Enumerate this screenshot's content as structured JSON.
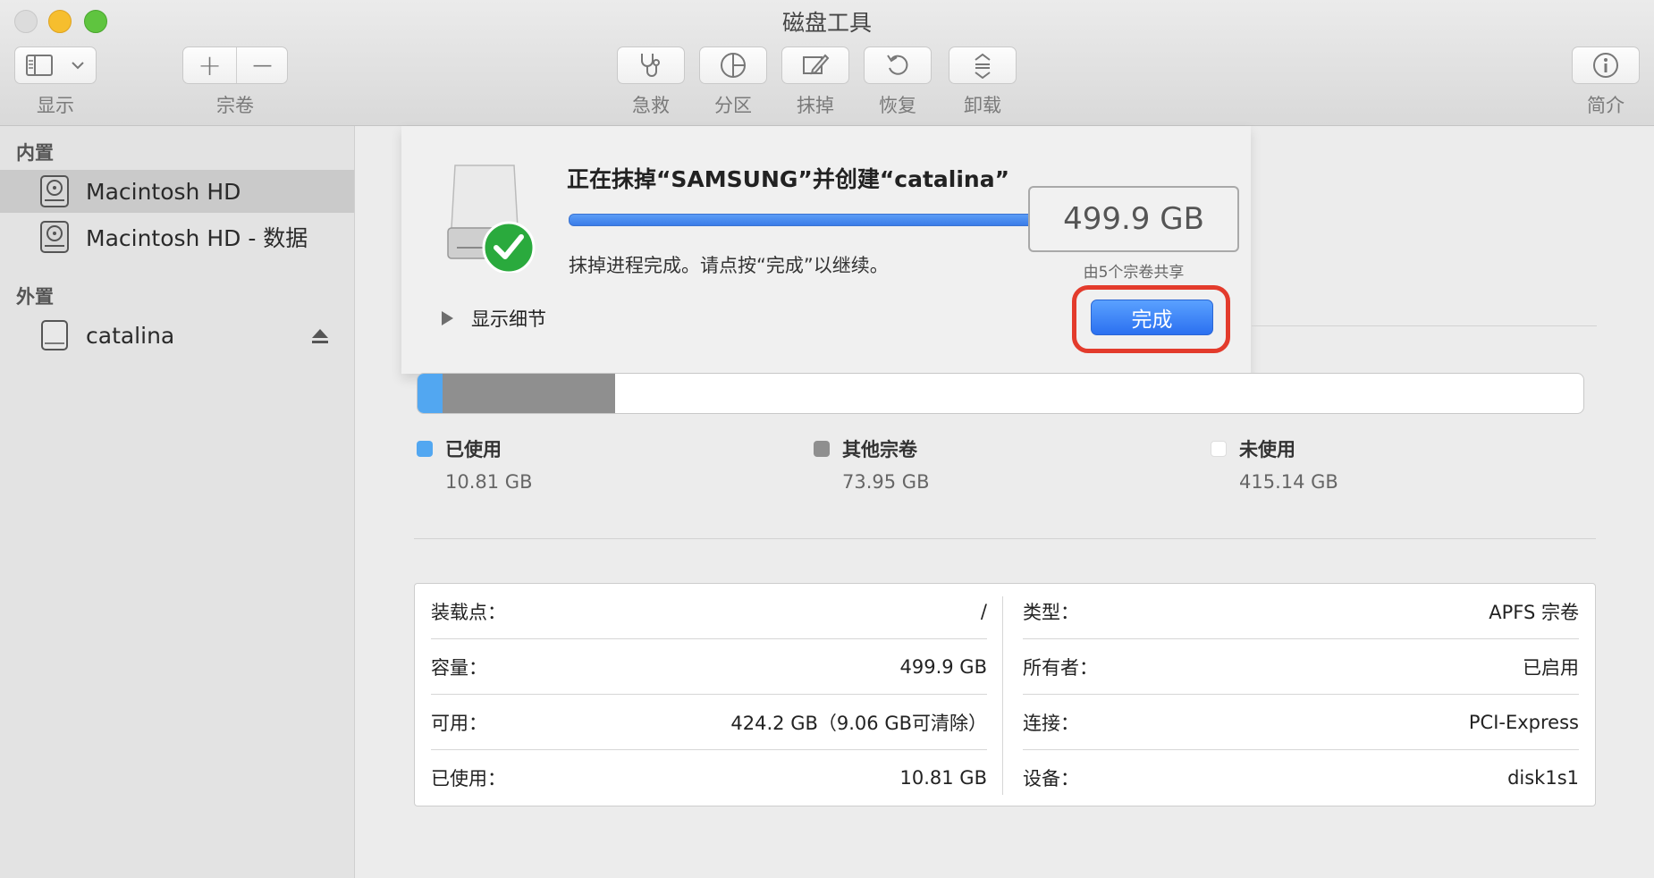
{
  "window": {
    "title": "磁盘工具"
  },
  "toolbar": {
    "view_label": "显示",
    "volume_label": "宗卷",
    "firstaid_label": "急救",
    "partition_label": "分区",
    "erase_label": "抹掉",
    "restore_label": "恢复",
    "unmount_label": "卸载",
    "info_label": "简介",
    "add_symbol": "+",
    "remove_symbol": "—"
  },
  "sidebar": {
    "internal_header": "内置",
    "external_header": "外置",
    "internal_items": [
      {
        "label": "Macintosh HD",
        "selected": true
      },
      {
        "label": "Macintosh HD - 数据",
        "selected": false
      }
    ],
    "external_items": [
      {
        "label": "catalina"
      }
    ]
  },
  "sheet": {
    "title": "正在抹掉“SAMSUNG”并创建“catalina”",
    "progress": 1.0,
    "message": "抹掉进程完成。请点按“完成”以继续。",
    "details_label": "显示细节",
    "done_label": "完成"
  },
  "capacity": {
    "value": "499.9 GB",
    "subtitle": "由5个宗卷共享"
  },
  "usage": {
    "used_label": "已使用",
    "used_value": "10.81 GB",
    "used_fraction": 0.0216,
    "other_label": "其他宗卷",
    "other_value": "73.95 GB",
    "other_fraction": 0.148,
    "free_label": "未使用",
    "free_value": "415.14 GB"
  },
  "details": {
    "left": [
      {
        "key": "装载点：",
        "value": "/"
      },
      {
        "key": "容量：",
        "value": "499.9 GB"
      },
      {
        "key": "可用：",
        "value": "424.2 GB（9.06 GB可清除）"
      },
      {
        "key": "已使用：",
        "value": "10.81 GB"
      }
    ],
    "right": [
      {
        "key": "类型：",
        "value": "APFS 宗卷"
      },
      {
        "key": "所有者：",
        "value": "已启用"
      },
      {
        "key": "连接：",
        "value": "PCI-Express"
      },
      {
        "key": "设备：",
        "value": "disk1s1"
      }
    ]
  },
  "colors": {
    "used": "#52a7f1",
    "other": "#8f8f8f",
    "accent": "#2b70f0",
    "highlight": "#e33b2c"
  }
}
